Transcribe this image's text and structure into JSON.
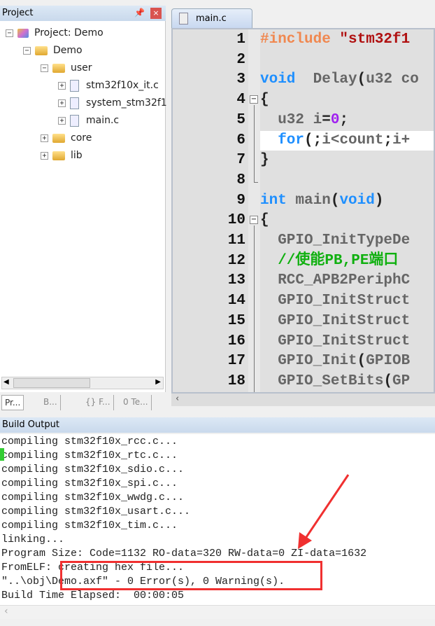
{
  "project": {
    "title": "Project",
    "pin_icon": "pin-icon",
    "close_icon": "close-icon",
    "tree": [
      {
        "label": "Project: Demo",
        "level": 0,
        "toggle": "−",
        "icon": "project-icon"
      },
      {
        "label": "Demo",
        "level": 1,
        "toggle": "−",
        "icon": "folder-open-icon"
      },
      {
        "label": "user",
        "level": 2,
        "toggle": "−",
        "icon": "folder-open-icon"
      },
      {
        "label": "stm32f10x_it.c",
        "level": 3,
        "toggle": "+",
        "icon": "file-icon"
      },
      {
        "label": "system_stm32f1",
        "level": 3,
        "toggle": "+",
        "icon": "file-key-icon"
      },
      {
        "label": "main.c",
        "level": 3,
        "toggle": "+",
        "icon": "file-icon"
      },
      {
        "label": "core",
        "level": 2,
        "toggle": "+",
        "icon": "folder-icon"
      },
      {
        "label": "lib",
        "level": 2,
        "toggle": "+",
        "icon": "folder-icon"
      }
    ],
    "tabs": [
      "Pr...",
      "B...",
      "{} F...",
      "0 Te..."
    ]
  },
  "editor": {
    "tab": "main.c",
    "line_numbers": [
      "1",
      "2",
      "3",
      "4",
      "5",
      "6",
      "7",
      "8",
      "9",
      "10",
      "11",
      "12",
      "13",
      "14",
      "15",
      "16",
      "17",
      "18"
    ],
    "current_line": 6,
    "lines": [
      [
        [
          "pp",
          "#include "
        ],
        [
          "str",
          "\"stm32f1"
        ]
      ],
      [],
      [
        [
          "kw",
          "void"
        ],
        [
          "",
          "  Delay"
        ],
        [
          "pu",
          "("
        ],
        [
          "",
          "u32 co"
        ]
      ],
      [
        [
          "pu",
          "{"
        ]
      ],
      [
        [
          "",
          "  u32 i"
        ],
        [
          "pu",
          "="
        ],
        [
          "num",
          "0"
        ],
        [
          "pu",
          ";"
        ]
      ],
      [
        [
          "kw",
          "  for"
        ],
        [
          "pu",
          "(;"
        ],
        [
          "",
          "i<count"
        ],
        [
          "pu",
          ";"
        ],
        [
          "",
          "i+"
        ]
      ],
      [
        [
          "pu",
          "}"
        ]
      ],
      [],
      [
        [
          "kw",
          "int"
        ],
        [
          "",
          " main"
        ],
        [
          "pu",
          "("
        ],
        [
          "kw",
          "void"
        ],
        [
          "pu",
          ")"
        ]
      ],
      [
        [
          "pu",
          "{"
        ]
      ],
      [
        [
          "",
          "  GPIO_InitTypeDe"
        ]
      ],
      [
        [
          "cm",
          "  //使能PB,PE端口"
        ]
      ],
      [
        [
          "",
          "  RCC_APB2PeriphC"
        ]
      ],
      [
        [
          "",
          "  GPIO_InitStruct"
        ]
      ],
      [
        [
          "",
          "  GPIO_InitStruct"
        ]
      ],
      [
        [
          "",
          "  GPIO_InitStruct"
        ]
      ],
      [
        [
          "",
          "  GPIO_Init"
        ],
        [
          "pu",
          "("
        ],
        [
          "",
          "GPIOB"
        ]
      ],
      [
        [
          "",
          "  GPIO_SetBits"
        ],
        [
          "pu",
          "("
        ],
        [
          "",
          "GP"
        ]
      ]
    ]
  },
  "build": {
    "title": "Build Output",
    "lines": [
      "compiling stm32f10x_rcc.c...",
      "compiling stm32f10x_rtc.c...",
      "compiling stm32f10x_sdio.c...",
      "compiling stm32f10x_spi.c...",
      "compiling stm32f10x_wwdg.c...",
      "compiling stm32f10x_usart.c...",
      "compiling stm32f10x_tim.c...",
      "linking...",
      "Program Size: Code=1132 RO-data=320 RW-data=0 ZI-data=1632",
      "FromELF: creating hex file...",
      "\"..\\obj\\Demo.axf\" - 0 Error(s), 0 Warning(s).",
      "Build Time Elapsed:  00:00:05"
    ]
  },
  "annotation_color": "#f03030"
}
